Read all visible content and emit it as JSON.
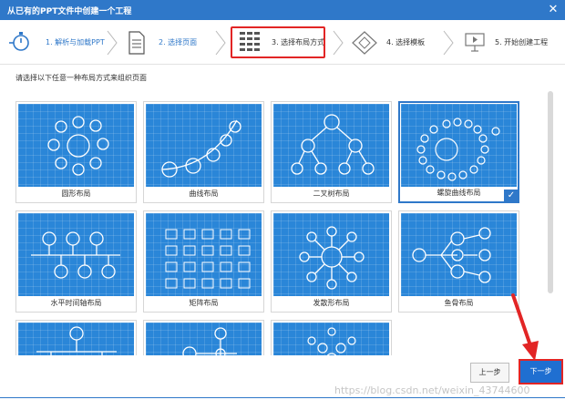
{
  "window": {
    "title": "从已有的PPT文件中创建一个工程",
    "close_glyph": "✕"
  },
  "steps": [
    {
      "label": "1. 解析与加载PPT",
      "icon": "stopwatch-icon",
      "state": "done"
    },
    {
      "label": "2. 选择页面",
      "icon": "document-icon",
      "state": "done"
    },
    {
      "label": "3. 选择布局方式",
      "icon": "layout-grid-icon",
      "state": "current"
    },
    {
      "label": "4. 选择模板",
      "icon": "diamond-icon",
      "state": "pending"
    },
    {
      "label": "5. 开始创建工程",
      "icon": "presentation-icon",
      "state": "pending"
    }
  ],
  "instruction": "请选择以下任意一种布局方式来组织页面",
  "layouts": [
    {
      "label": "圆形布局",
      "selected": false
    },
    {
      "label": "曲线布局",
      "selected": false
    },
    {
      "label": "二叉树布局",
      "selected": false
    },
    {
      "label": "螺旋曲线布局",
      "selected": true
    },
    {
      "label": "水平时间轴布局",
      "selected": false
    },
    {
      "label": "矩阵布局",
      "selected": false
    },
    {
      "label": "发散形布局",
      "selected": false
    },
    {
      "label": "鱼骨布局",
      "selected": false
    },
    {
      "label": "",
      "selected": false
    },
    {
      "label": "",
      "selected": false
    },
    {
      "label": "",
      "selected": false
    }
  ],
  "buttons": {
    "prev": "上一步",
    "next": "下一步"
  },
  "watermark": "https://blog.csdn.net/weixin_43744600",
  "colors": {
    "accent": "#2f78c9",
    "annotation": "#e22525",
    "thumb_bg": "#2a86d8"
  }
}
